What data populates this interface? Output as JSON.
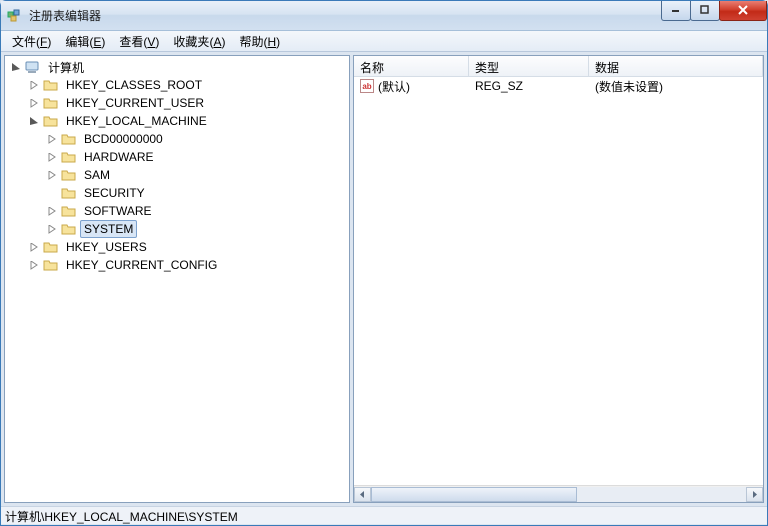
{
  "window": {
    "title": "注册表编辑器"
  },
  "menu": {
    "file": {
      "label": "文件",
      "accel": "F"
    },
    "edit": {
      "label": "编辑",
      "accel": "E"
    },
    "view": {
      "label": "查看",
      "accel": "V"
    },
    "favorites": {
      "label": "收藏夹",
      "accel": "A"
    },
    "help": {
      "label": "帮助",
      "accel": "H"
    }
  },
  "tree": {
    "root_label": "计算机",
    "hives": {
      "hkcr": "HKEY_CLASSES_ROOT",
      "hkcu": "HKEY_CURRENT_USER",
      "hklm": "HKEY_LOCAL_MACHINE",
      "hku": "HKEY_USERS",
      "hkcc": "HKEY_CURRENT_CONFIG"
    },
    "hklm_children": {
      "bcd": "BCD00000000",
      "hardware": "HARDWARE",
      "sam": "SAM",
      "security": "SECURITY",
      "software": "SOFTWARE",
      "system": "SYSTEM"
    }
  },
  "list": {
    "columns": {
      "name": "名称",
      "type": "类型",
      "data": "数据"
    },
    "rows": [
      {
        "name": "(默认)",
        "type": "REG_SZ",
        "data": "(数值未设置)"
      }
    ]
  },
  "status": {
    "path": "计算机\\HKEY_LOCAL_MACHINE\\SYSTEM"
  }
}
